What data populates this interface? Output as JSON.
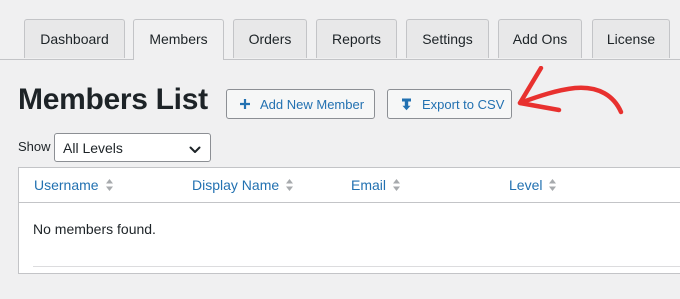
{
  "tabs": [
    {
      "label": "Dashboard",
      "active": false
    },
    {
      "label": "Members",
      "active": true
    },
    {
      "label": "Orders",
      "active": false
    },
    {
      "label": "Reports",
      "active": false
    },
    {
      "label": "Settings",
      "active": false
    },
    {
      "label": "Add Ons",
      "active": false
    },
    {
      "label": "License",
      "active": false
    }
  ],
  "page": {
    "title": "Members List",
    "add_button": {
      "label": "Add New Member",
      "icon": "plus-icon"
    },
    "export_button": {
      "label": "Export to CSV",
      "icon": "download-icon"
    },
    "annotation": {
      "icon": "red-arrow-icon",
      "color": "#e8312f"
    }
  },
  "filter": {
    "show_label": "Show",
    "selected_level": "All Levels"
  },
  "table": {
    "columns": [
      "Username",
      "Display Name",
      "Email",
      "Level"
    ],
    "empty_message": "No members found."
  },
  "colors": {
    "link": "#2271b1",
    "text": "#1d2327",
    "background": "#f0f0f1",
    "border": "#c3c4c7"
  }
}
